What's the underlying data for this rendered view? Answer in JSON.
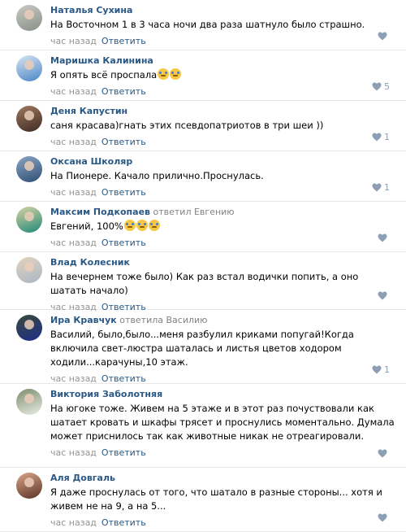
{
  "comments": [
    {
      "author": "Наталья Сухина",
      "reply_prefix": "",
      "reply_to": "",
      "text": "На Восточном 1 в 3 часа ночи два раза шатнуло было страшно.",
      "time": "час назад",
      "reply": "Ответить",
      "likes": "",
      "avatar_colors": [
        "#8a8f86",
        "#c7cbc4"
      ]
    },
    {
      "author": "Маришка Калинина",
      "reply_prefix": "",
      "reply_to": "",
      "text": "Я опять всё проспала",
      "emoji": [
        "crying-emoji",
        "crying-emoji"
      ],
      "time": "час назад",
      "reply": "Ответить",
      "likes": "5",
      "avatar_colors": [
        "#4a86c8",
        "#d9e4ef"
      ]
    },
    {
      "author": "Деня Капустин",
      "reply_prefix": "",
      "reply_to": "",
      "text": "саня красава)гнать этих псевдопатриотов в три шеи ))",
      "time": "час назад",
      "reply": "Ответить",
      "likes": "1",
      "avatar_colors": [
        "#3d2b22",
        "#a07861"
      ]
    },
    {
      "author": "Оксана Школяр",
      "reply_prefix": "",
      "reply_to": "",
      "text": "На Пионере. Качало прилично.Проснулась.",
      "time": "час назад",
      "reply": "Ответить",
      "likes": "1",
      "avatar_colors": [
        "#2f4f73",
        "#8aa5c4"
      ]
    },
    {
      "author": "Максим Подкопаев",
      "reply_prefix": "ответил",
      "reply_to": "Евгению",
      "text": "Евгений, 100%",
      "emoji": [
        "crying-emoji",
        "crying-emoji",
        "crying-emoji"
      ],
      "time": "час назад",
      "reply": "Ответить",
      "likes": "",
      "avatar_colors": [
        "#1f8a7a",
        "#d8d2a0"
      ]
    },
    {
      "author": "Влад Колесник",
      "reply_prefix": "",
      "reply_to": "",
      "text": "На вечернем тоже было) Как раз встал водички попить, а оно шатать начало)",
      "time": "час назад",
      "reply": "Ответить",
      "likes": "",
      "avatar_colors": [
        "#a9b8c4",
        "#e4d2c0"
      ]
    },
    {
      "author": "Ира Кравчук",
      "reply_prefix": "ответила",
      "reply_to": "Василию",
      "text": "Василий, было,было...меня разбулил криками попугай!Когда включила свет-люстра шаталась и листья цветов ходором ходили...карачуны,10 этаж.",
      "time": "час назад",
      "reply": "Ответить",
      "likes": "1",
      "avatar_colors": [
        "#1d2e8c",
        "#3a4a3a"
      ]
    },
    {
      "author": "Виктория Заболотняя",
      "reply_prefix": "",
      "reply_to": "",
      "text": "На югоке тоже. Живем на 5 этаже и в этот раз почуствовали как шатает кровать и шкафы трясет и проснулись моментально. Думала может приснилось так как животные никак не отреагировали.",
      "time": "час назад",
      "reply": "Ответить",
      "likes": "",
      "avatar_colors": [
        "#e9ece6",
        "#7c8d6c"
      ]
    },
    {
      "author": "Аля Довгаль",
      "reply_prefix": "",
      "reply_to": "",
      "text": "Я даже проснулась от того, что шатало в разные стороны... хотя и живем не на 9, а на 5...",
      "time": "час назад",
      "reply": "Ответить",
      "likes": "",
      "avatar_colors": [
        "#5a3526",
        "#d9a488"
      ]
    }
  ],
  "colors": {
    "link": "#2a5885",
    "meta": "#939393",
    "like": "#8d9fb4",
    "divider": "#e7e8ec"
  }
}
